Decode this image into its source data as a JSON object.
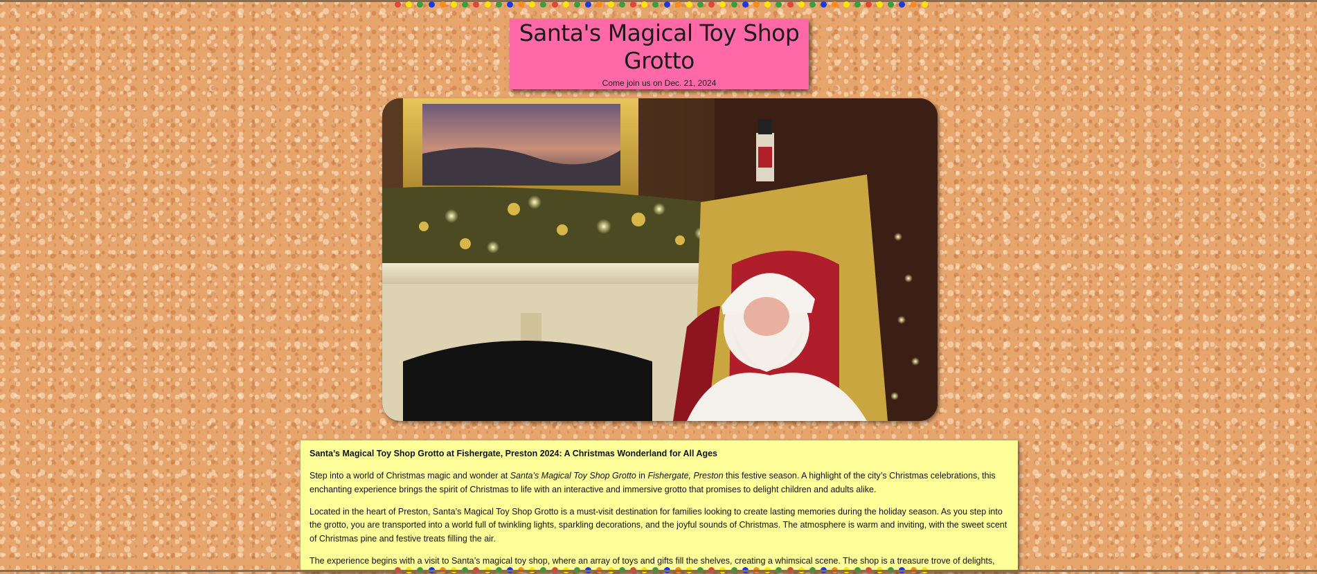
{
  "page": {
    "title": "Santa's Magical Toy Shop Grotto",
    "subtitle": "Come join us on Dec. 21, 2024"
  },
  "photo": {
    "alt": "Santa Claus seated in a golden throne beside a decorated fireplace with garland and twinkling lights"
  },
  "article": {
    "heading": "Santa’s Magical Toy Shop Grotto at Fishergate, Preston 2024: A Christmas Wonderland for All Ages",
    "p1": {
      "pre": "Step into a world of Christmas magic and wonder at ",
      "em1": "Santa’s Magical Toy Shop Grotto",
      "mid": " in ",
      "em2": "Fishergate, Preston",
      "post": " this festive season. A highlight of the city’s Christmas celebrations, this enchanting experience brings the spirit of Christmas to life with an interactive and immersive grotto that promises to delight children and adults alike."
    },
    "p2": "Located in the heart of Preston, Santa’s Magical Toy Shop Grotto is a must-visit destination for families looking to create lasting memories during the holiday season. As you step into the grotto, you are transported into a world full of twinkling lights, sparkling decorations, and the joyful sounds of Christmas. The atmosphere is warm and inviting, with the sweet scent of Christmas pine and festive treats filling the air.",
    "p3": "The experience begins with a visit to Santa’s magical toy shop, where an array of toys and gifts fill the shelves, creating a whimsical scene. The shop is a treasure trove of delights, with"
  },
  "colors": {
    "title_card": "#ff69a8",
    "text_card": "#ffff99",
    "bulbs": [
      "#e0463a",
      "#ffe400",
      "#36a040",
      "#1a3ae0",
      "#ff8a1a",
      "#ffe400",
      "#36a040"
    ]
  }
}
